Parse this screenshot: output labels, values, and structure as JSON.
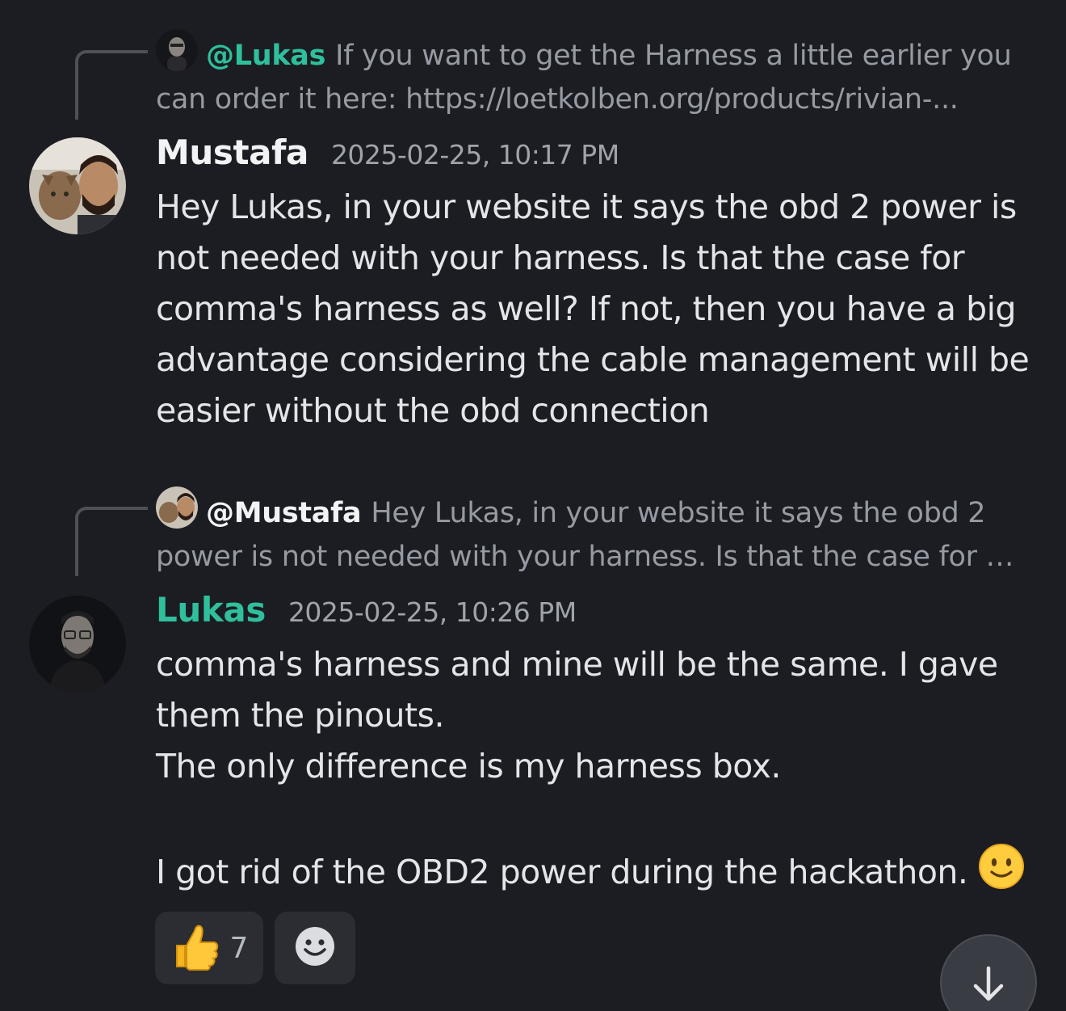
{
  "messages": [
    {
      "reply": {
        "mention": "@Lukas",
        "preview": "If you want to get the Harness a little earlier you can order it here: https://loetkolben.org/products/rivian-..."
      },
      "author": "Mustafa",
      "timestamp": "2025-02-25, 10:17 PM",
      "text": "Hey Lukas, in your website it says the obd 2 power is not needed with your harness. Is that the case for comma's harness as well? If not, then you have a big advantage considering the cable management will be easier without the obd connection"
    },
    {
      "reply": {
        "mention": "@Mustafa",
        "preview": "Hey Lukas, in your website it says the obd 2 power is not needed with your harness. Is that the case for …"
      },
      "author": "Lukas",
      "timestamp": "2025-02-25, 10:26 PM",
      "text": "comma's harness and mine will be the same. I gave them the pinouts.\nThe only difference is my harness box.\n\nI got rid of the OBD2 power during the hackathon. ",
      "reactions": [
        {
          "emoji": "thumbs-up-icon",
          "count": "7"
        },
        {
          "emoji": "add-reaction-icon",
          "count": ""
        }
      ]
    }
  ],
  "colors": {
    "background": "#1c1d22",
    "accent_teal": "#2fbf9d",
    "muted_text": "#969aa3"
  }
}
